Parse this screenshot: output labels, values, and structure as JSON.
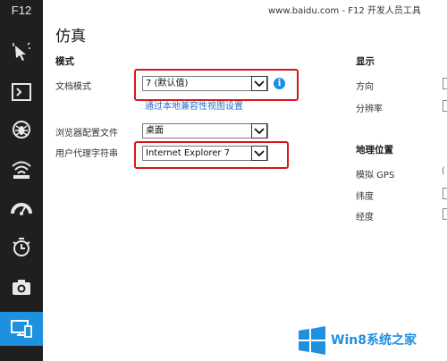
{
  "sidebar": {
    "title": "F12",
    "items": [
      {
        "name": "dom-explorer",
        "icon": "pointer-select-icon"
      },
      {
        "name": "console",
        "icon": "console-icon"
      },
      {
        "name": "debugger",
        "icon": "bug-icon"
      },
      {
        "name": "network",
        "icon": "wifi-icon"
      },
      {
        "name": "performance",
        "icon": "gauge-icon"
      },
      {
        "name": "memory",
        "icon": "timer-icon"
      },
      {
        "name": "profiler",
        "icon": "camera-icon"
      },
      {
        "name": "emulation",
        "icon": "devices-icon",
        "active": true
      }
    ]
  },
  "titlebar": "www.baidu.com - F12 开发人员工具",
  "page_title": "仿真",
  "mode": {
    "heading": "模式",
    "document_mode_label": "文档模式",
    "document_mode_value": "7 (默认值)",
    "compat_link": "通过本地兼容性视图设置",
    "browser_profile_label": "浏览器配置文件",
    "browser_profile_value": "桌面",
    "user_agent_label": "用户代理字符串",
    "user_agent_value": "Internet Explorer 7"
  },
  "display": {
    "heading": "显示",
    "orientation_label": "方向",
    "resolution_label": "分辨率"
  },
  "geolocation": {
    "heading": "地理位置",
    "gps_label": "模拟 GPS",
    "latitude_label": "纬度",
    "longitude_label": "经度",
    "gps_cut_char": "("
  },
  "watermark": {
    "text": "Win8系统之家"
  },
  "colors": {
    "accent": "#1e90e0",
    "highlight": "#d9141b",
    "sidebar": "#1f1f1f"
  }
}
